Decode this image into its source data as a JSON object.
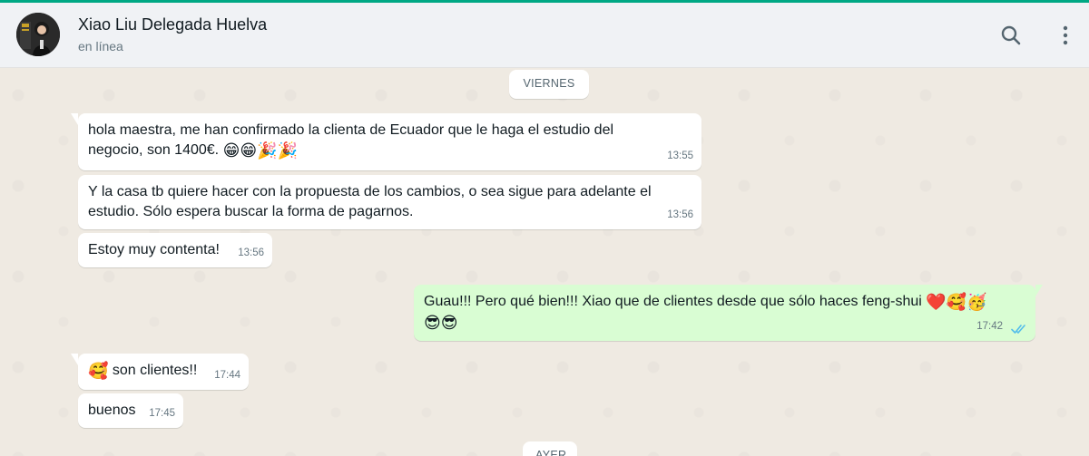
{
  "header": {
    "contact_name": "Xiao Liu Delegada Huelva",
    "contact_status": "en línea",
    "search_icon": "search-icon",
    "menu_icon": "kebab-menu-icon"
  },
  "colors": {
    "accent": "#00a884",
    "incoming_bubble": "#ffffff",
    "outgoing_bubble": "#d9fdd3",
    "read_ticks": "#53bdeb"
  },
  "chat": {
    "date_chip": "VIERNES",
    "next_date_chip": "AYER",
    "messages": [
      {
        "direction": "in",
        "lines": [
          "hola maestra, me han confirmado la clienta de Ecuador que le haga el estudio del",
          "negocio, son 1400€."
        ],
        "emojis": [
          "😁",
          "😁",
          "🎉",
          "🎉"
        ],
        "time": "13:55"
      },
      {
        "direction": "in",
        "lines": [
          "Y la casa tb quiere hacer con la propuesta de los cambios, o sea sigue para adelante el",
          "estudio. Sólo espera buscar la forma de pagarnos."
        ],
        "time": "13:56"
      },
      {
        "direction": "in",
        "lines": [
          "Estoy muy contenta!"
        ],
        "time": "13:56"
      },
      {
        "direction": "out",
        "lines": [
          "Guau!!! Pero qué bien!!! Xiao que de clientes desde que sólo haces feng-shui"
        ],
        "emojis_line1": [
          "❤️",
          "🥰",
          "🥳"
        ],
        "emojis_line2": [
          "😎",
          "😎"
        ],
        "time": "17:42",
        "status": "read"
      },
      {
        "direction": "in",
        "lines": [
          "son clientes!!"
        ],
        "emojis": [
          "🥰"
        ],
        "time": "17:44"
      },
      {
        "direction": "in",
        "lines": [
          "buenos"
        ],
        "time": "17:45"
      }
    ]
  }
}
